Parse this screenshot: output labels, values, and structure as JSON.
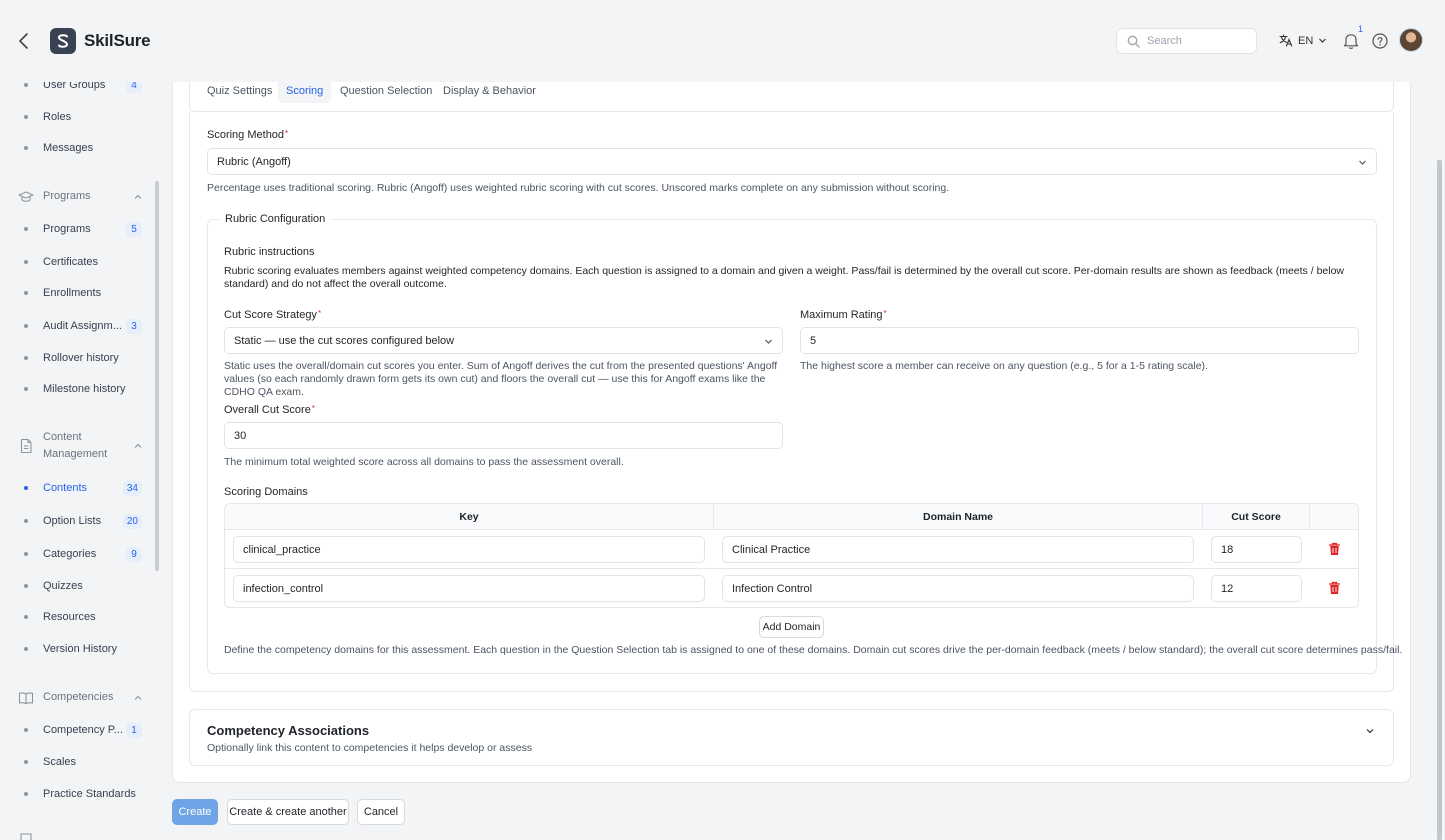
{
  "header": {
    "brand": "SkilSure",
    "search_placeholder": "Search",
    "language": "EN",
    "notification_count": "1"
  },
  "sidebar": {
    "items_top": [
      {
        "label": "User Groups",
        "count": "4"
      },
      {
        "label": "Roles",
        "count": ""
      },
      {
        "label": "Messages",
        "count": ""
      }
    ],
    "group_programs": "Programs",
    "programs_items": [
      {
        "label": "Programs",
        "count": "5"
      },
      {
        "label": "Certificates",
        "count": ""
      },
      {
        "label": "Enrollments",
        "count": ""
      },
      {
        "label": "Audit Assignm...",
        "count": "3"
      },
      {
        "label": "Rollover history",
        "count": ""
      },
      {
        "label": "Milestone history",
        "count": ""
      }
    ],
    "group_content": "Content Management",
    "content_items": [
      {
        "label": "Contents",
        "count": "34"
      },
      {
        "label": "Option Lists",
        "count": "20"
      },
      {
        "label": "Categories",
        "count": "9"
      },
      {
        "label": "Quizzes",
        "count": ""
      },
      {
        "label": "Resources",
        "count": ""
      },
      {
        "label": "Version History",
        "count": ""
      }
    ],
    "group_competencies": "Competencies",
    "competency_items": [
      {
        "label": "Competency P...",
        "count": "1"
      },
      {
        "label": "Scales",
        "count": ""
      },
      {
        "label": "Practice Standards",
        "count": ""
      }
    ]
  },
  "tabs": [
    "Quiz Settings",
    "Scoring",
    "Question Selection",
    "Display & Behavior"
  ],
  "scoring": {
    "method_label": "Scoring Method",
    "method_value": "Rubric (Angoff)",
    "method_help": "Percentage uses traditional scoring. Rubric (Angoff) uses weighted rubric scoring with cut scores. Unscored marks complete on any submission without scoring.",
    "rubric_legend": "Rubric Configuration",
    "instructions_title": "Rubric instructions",
    "instructions_text": "Rubric scoring evaluates members against weighted competency domains. Each question is assigned to a domain and given a weight. Pass/fail is determined by the overall cut score. Per-domain results are shown as feedback (meets / below standard) and do not affect the overall outcome.",
    "strategy_label": "Cut Score Strategy",
    "strategy_value": "Static — use the cut scores configured below",
    "strategy_help": "Static uses the overall/domain cut scores you enter. Sum of Angoff derives the cut from the presented questions' Angoff values (so each randomly drawn form gets its own cut) and floors the overall cut — use this for Angoff exams like the CDHO QA exam.",
    "max_rating_label": "Maximum Rating",
    "max_rating_value": "5",
    "max_rating_help": "The highest score a member can receive on any question (e.g., 5 for a 1-5 rating scale).",
    "overall_label": "Overall Cut Score",
    "overall_value": "30",
    "overall_help": "The minimum total weighted score across all domains to pass the assessment overall.",
    "domains_label": "Scoring Domains",
    "columns": [
      "Key",
      "Domain Name",
      "Cut Score"
    ],
    "domains": [
      {
        "key": "clinical_practice",
        "name": "Clinical Practice",
        "cut": "18"
      },
      {
        "key": "infection_control",
        "name": "Infection Control",
        "cut": "12"
      }
    ],
    "add_domain": "Add Domain",
    "domains_help": "Define the competency domains for this assessment. Each question in the Question Selection tab is assigned to one of these domains. Domain cut scores drive the per-domain feedback (meets / below standard); the overall cut score determines pass/fail."
  },
  "associations": {
    "title": "Competency Associations",
    "subtitle": "Optionally link this content to competencies it helps develop or assess"
  },
  "footer": {
    "create": "Create",
    "create_another": "Create & create another",
    "cancel": "Cancel"
  },
  "colors": {
    "accent": "#2563eb",
    "danger": "#dc2626",
    "primary_button": "#6ea4e6"
  }
}
